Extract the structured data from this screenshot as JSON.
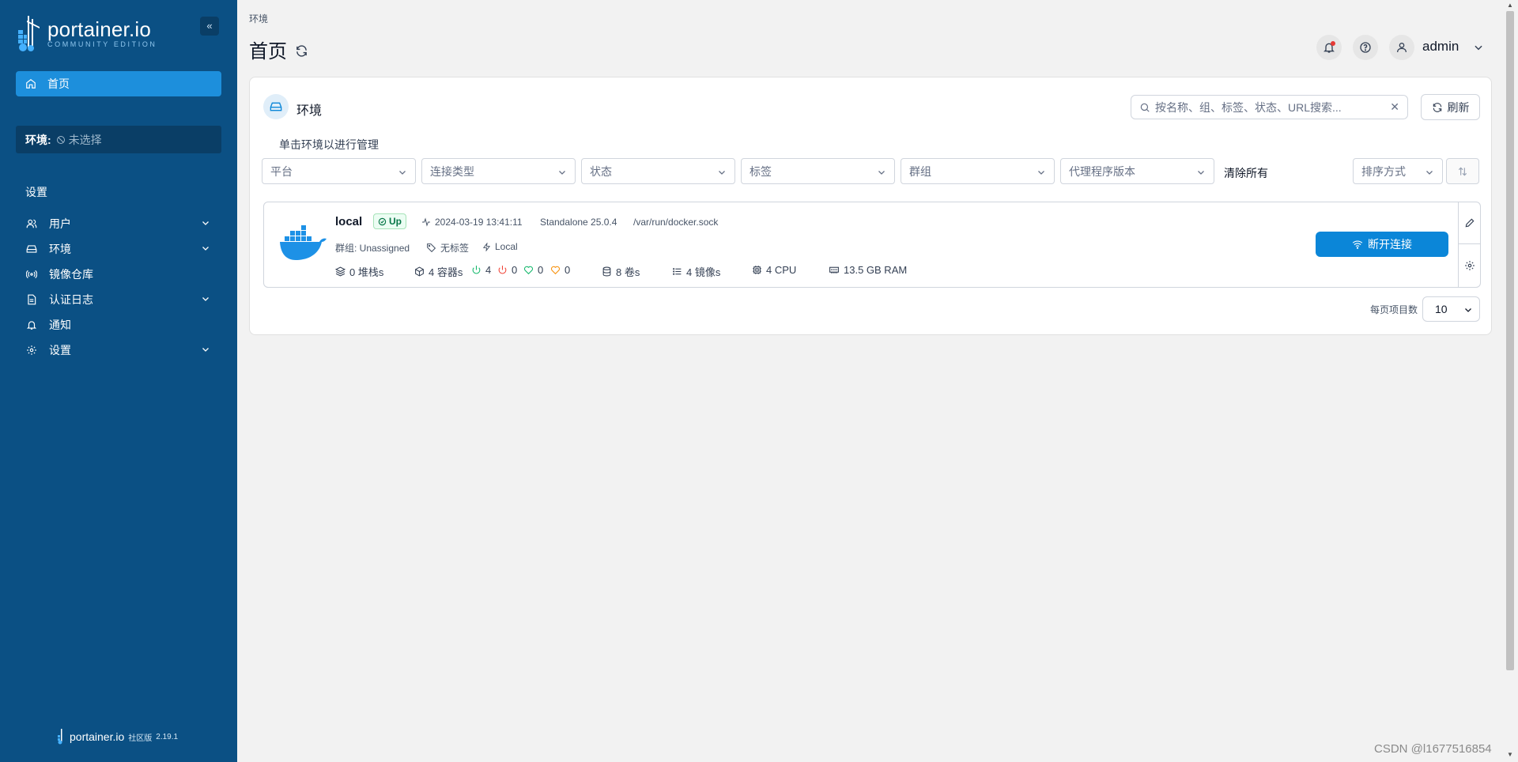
{
  "sidebar": {
    "logo_main": "portainer.io",
    "logo_sub": "COMMUNITY EDITION",
    "collapse_label": "«",
    "home_label": "首页",
    "env_label": "环境:",
    "env_value": "未选择",
    "section_title": "设置",
    "items": [
      {
        "label": "用户",
        "icon": "users-icon",
        "expandable": true
      },
      {
        "label": "环境",
        "icon": "hard-drive-icon",
        "expandable": true
      },
      {
        "label": "镜像仓库",
        "icon": "radio-icon",
        "expandable": false
      },
      {
        "label": "认证日志",
        "icon": "file-text-icon",
        "expandable": true
      },
      {
        "label": "通知",
        "icon": "bell-icon",
        "expandable": false
      },
      {
        "label": "设置",
        "icon": "gear-icon",
        "expandable": true
      }
    ],
    "footer_brand": "portainer.io",
    "footer_edition": "社区版",
    "footer_version": "2.19.1"
  },
  "header": {
    "breadcrumb": "环境",
    "title": "首页",
    "user_name": "admin"
  },
  "panel": {
    "title": "环境",
    "search_placeholder": "按名称、组、标签、状态、URL搜索...",
    "refresh_label": "刷新",
    "hint": "单击环境以进行管理",
    "filters": [
      "平台",
      "连接类型",
      "状态",
      "标签",
      "群组",
      "代理程序版本"
    ],
    "clear_all": "清除所有",
    "sort_label": "排序方式"
  },
  "environment": {
    "name": "local",
    "status": "Up",
    "timestamp": "2024-03-19 13:41:11",
    "engine": "Standalone 25.0.4",
    "socket": "/var/run/docker.sock",
    "group": "群组: Unassigned",
    "tags": "无标签",
    "type": "Local",
    "stacks": "0 堆栈s",
    "containers": "4 容器s",
    "running": "4",
    "stopped": "0",
    "healthy": "0",
    "unhealthy": "0",
    "volumes": "8 卷s",
    "images": "4 镜像s",
    "cpu": "4 CPU",
    "ram": "13.5 GB RAM",
    "disconnect_label": "断开连接"
  },
  "pagination": {
    "label": "每页项目数",
    "value": "10"
  },
  "watermark": "CSDN @l1677516854",
  "colors": {
    "sidebar": "#0b5084",
    "accent": "#1d8fdc",
    "primary_button": "#0b86d8"
  }
}
